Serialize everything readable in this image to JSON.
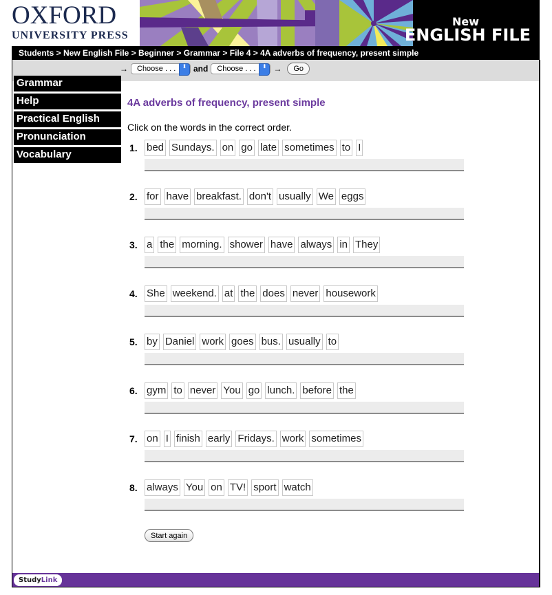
{
  "header": {
    "logo_line1": "OXFORD",
    "logo_line2": "UNIVERSITY PRESS",
    "brand_new": "New",
    "brand_name": "ENGLISH FILE",
    "colors": {
      "brand_navy": "#1c2a4f",
      "accent_purple": "#663399",
      "title_purple": "#6b3a9e"
    }
  },
  "breadcrumb": "Students > New English File > Beginner > Grammar > File 4 > 4A adverbs of frequency, present simple",
  "nav": {
    "arrow": "→",
    "select1": "Choose . . .",
    "and_label": "and",
    "select2": "Choose . . .",
    "arrow2": "→",
    "go_label": "Go",
    "stepper_glyph": "⬍"
  },
  "sidebar": {
    "items": [
      {
        "label": "Grammar"
      },
      {
        "label": "Help"
      },
      {
        "label": "Practical English"
      },
      {
        "label": "Pronunciation"
      },
      {
        "label": "Vocabulary"
      }
    ]
  },
  "main": {
    "title": "4A adverbs of frequency, present simple",
    "instructions": "Click on the words in the correct order.",
    "questions": [
      {
        "num": "1.",
        "words": [
          "bed",
          "Sundays.",
          "on",
          "go",
          "late",
          "sometimes",
          "to",
          "I"
        ]
      },
      {
        "num": "2.",
        "words": [
          "for",
          "have",
          "breakfast.",
          "don't",
          "usually",
          "We",
          "eggs"
        ]
      },
      {
        "num": "3.",
        "words": [
          "a",
          "the",
          "morning.",
          "shower",
          "have",
          "always",
          "in",
          "They"
        ]
      },
      {
        "num": "4.",
        "words": [
          "She",
          "weekend.",
          "at",
          "the",
          "does",
          "never",
          "housework"
        ]
      },
      {
        "num": "5.",
        "words": [
          "by",
          "Daniel",
          "work",
          "goes",
          "bus.",
          "usually",
          "to"
        ]
      },
      {
        "num": "6.",
        "words": [
          "gym",
          "to",
          "never",
          "You",
          "go",
          "lunch.",
          "before",
          "the"
        ]
      },
      {
        "num": "7.",
        "words": [
          "on",
          "I",
          "finish",
          "early",
          "Fridays.",
          "work",
          "sometimes"
        ]
      },
      {
        "num": "8.",
        "words": [
          "always",
          "You",
          "on",
          "TV!",
          "sport",
          "watch"
        ]
      }
    ],
    "start_again_label": "Start again"
  },
  "footer": {
    "study": "Study",
    "link": "Link"
  }
}
